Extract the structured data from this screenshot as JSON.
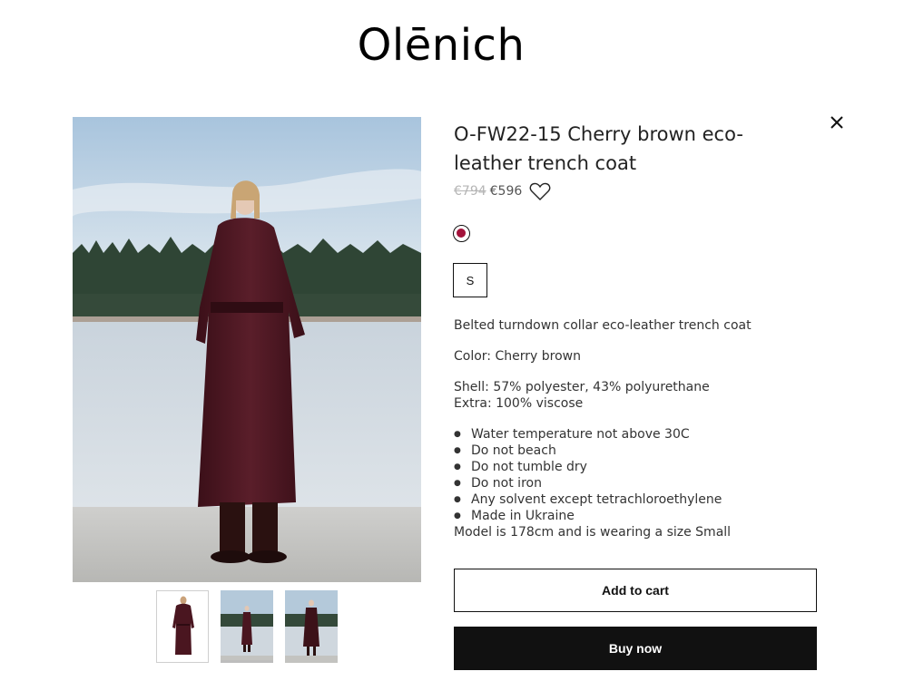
{
  "brand": {
    "logo_text": "Olēnich"
  },
  "product": {
    "title": "O-FW22-15 Cherry brown eco-leather trench coat",
    "old_price": "€794",
    "price": "€596",
    "swatch_color": "#a3123a",
    "sizes": [
      "S"
    ],
    "description": "Belted turndown collar eco-leather trench coat",
    "color_line": "Color: Cherry brown",
    "shell": "Shell: 57% polyester, 43% polyurethane",
    "extra": "Extra: 100% viscose",
    "care": [
      "Water temperature not above 30C",
      "Do not beach",
      "Do not tumble dry",
      "Do not iron",
      "Any solvent except tetrachloroethylene",
      "Made in Ukraine"
    ],
    "model_note": "Model is 178cm and is wearing a size Small"
  },
  "actions": {
    "add_to_cart": "Add to cart",
    "buy_now": "Buy now"
  },
  "icons": {
    "close": "close-icon",
    "wishlist": "heart-icon"
  },
  "colors": {
    "coat": "#4a1620",
    "button_dark": "#111111"
  }
}
